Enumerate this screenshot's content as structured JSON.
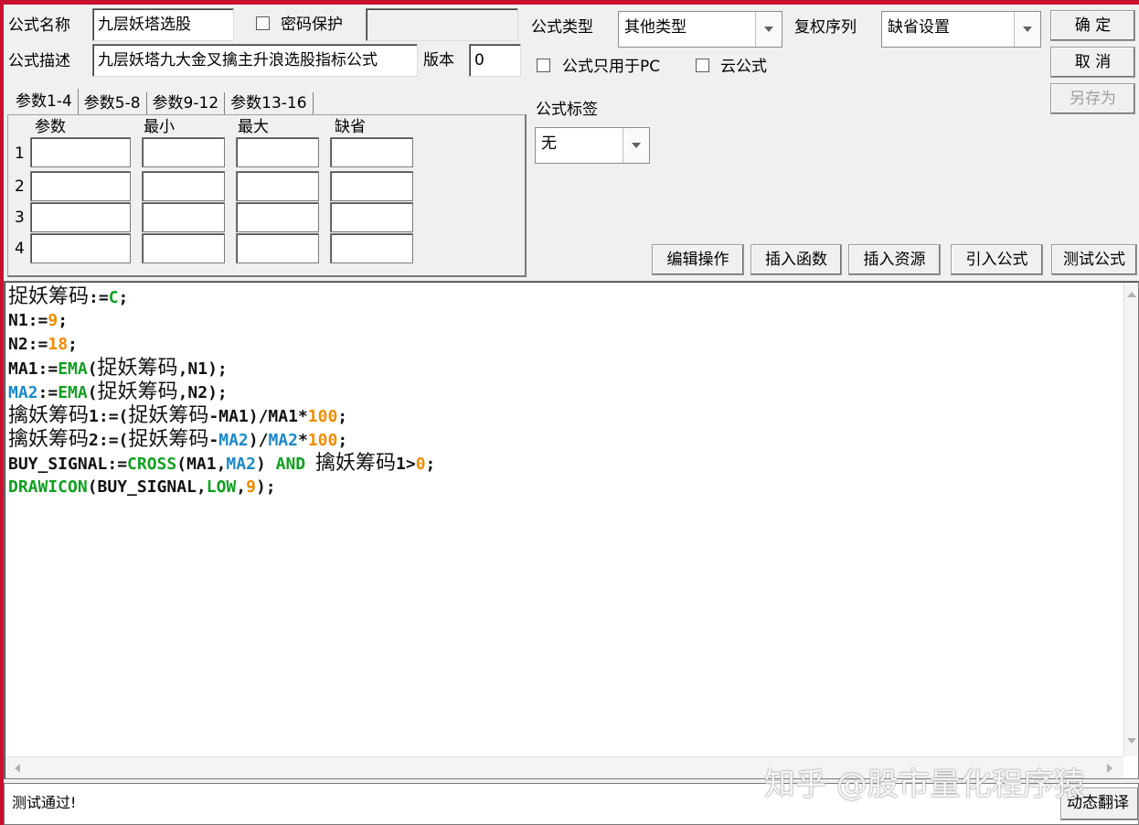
{
  "header": {
    "name_label": "公式名称",
    "name_value": "九层妖塔选股",
    "password_label": "密码保护",
    "desc_label": "公式描述",
    "desc_value": "九层妖塔九大金叉擒主升浪选股指标公式",
    "version_label": "版本",
    "version_value": "0",
    "type_label": "公式类型",
    "type_value": "其他类型",
    "restore_label": "复权序列",
    "restore_value": "缺省设置",
    "pc_only_label": "公式只用于PC",
    "cloud_label": "云公式",
    "tag_label": "公式标签",
    "tag_value": "无"
  },
  "buttons": {
    "ok": "确 定",
    "cancel": "取 消",
    "save_as": "另存为",
    "edit_ops": "编辑操作",
    "insert_func": "插入函数",
    "insert_res": "插入资源",
    "import_formula": "引入公式",
    "test_formula": "测试公式",
    "dynamic_translate": "动态翻译"
  },
  "tabs": [
    "参数1-4",
    "参数5-8",
    "参数9-12",
    "参数13-16"
  ],
  "params": {
    "col_param": "参数",
    "col_min": "最小",
    "col_max": "最大",
    "col_default": "缺省",
    "rows": [
      "1",
      "2",
      "3",
      "4"
    ]
  },
  "code": {
    "l1a": "捉妖筹码",
    "l1b": ":=",
    "l1c": "C",
    "l1d": ";",
    "l2a": "N1:=",
    "l2b": "9",
    "l2c": ";",
    "l3a": "N2:=",
    "l3b": "18",
    "l3c": ";",
    "l4a": "MA1:=",
    "l4b": "EMA",
    "l4c": "(",
    "l4d": "捉妖筹码",
    "l4e": ",N1);",
    "l5a": "MA2",
    "l5b": ":=",
    "l5c": "EMA",
    "l5d": "(",
    "l5e": "捉妖筹码",
    "l5f": ",N2);",
    "l6a": "擒妖筹码",
    "l6b": "1:=(",
    "l6c": "捉妖筹码",
    "l6d": "-MA1)/MA1*",
    "l6e": "100",
    "l6f": ";",
    "l7a": "擒妖筹码",
    "l7b": "2:=(",
    "l7c": "捉妖筹码",
    "l7d": "-",
    "l7e": "MA2",
    "l7f": ")/",
    "l7g": "MA2",
    "l7h": "*",
    "l7i": "100",
    "l7j": ";",
    "l8a": "BUY_SIGNAL:=",
    "l8b": "CROSS",
    "l8c": "(MA1,",
    "l8d": "MA2",
    "l8e": ") ",
    "l8f": "AND",
    "l8g": " ",
    "l8h": "擒妖筹码",
    "l8i": "1>",
    "l8j": "0",
    "l8k": ";",
    "l9a": "DRAWICON",
    "l9b": "(BUY_SIGNAL,",
    "l9c": "LOW",
    "l9d": ",",
    "l9e": "9",
    "l9f": ");"
  },
  "status": {
    "message": "测试通过!"
  },
  "watermark": "知乎 @股市量化程序猿",
  "colors": {
    "number": "#f08c00",
    "function": "#10a020",
    "variable": "#1a88c8",
    "accent_red": "#c8102e"
  }
}
